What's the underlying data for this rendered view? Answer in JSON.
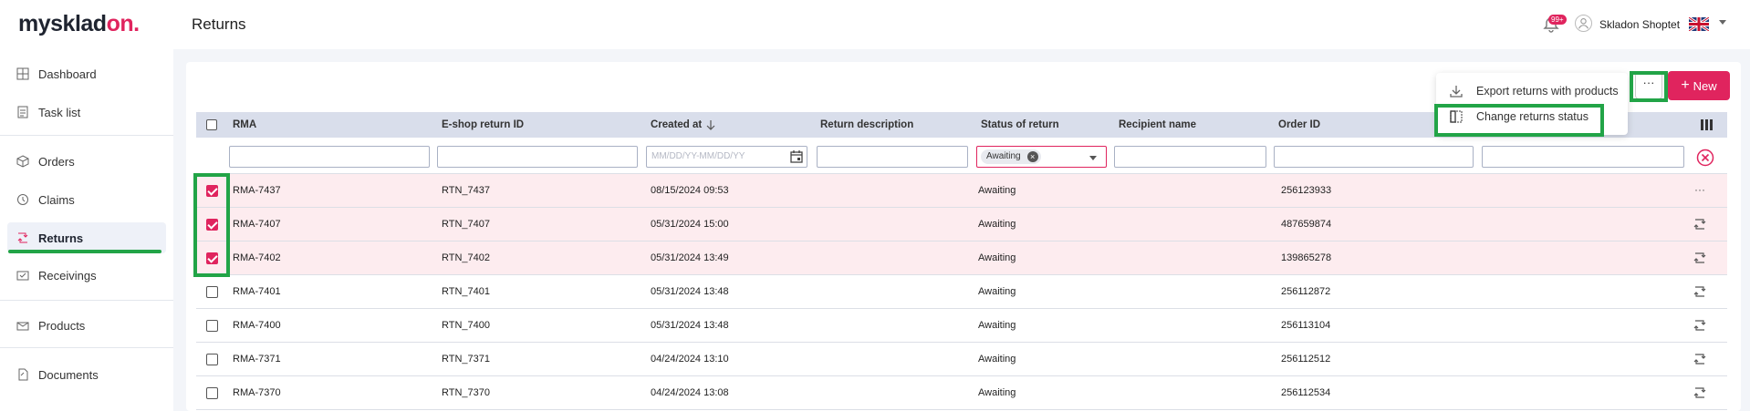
{
  "header": {
    "logo_main": "mysklad",
    "logo_accent": "on",
    "logo_dot": ".",
    "page_title": "Returns",
    "notification_badge": "99+",
    "user_name": "Skladon Shoptet"
  },
  "sidebar": {
    "items": [
      {
        "label": "Dashboard",
        "icon": "dashboard-icon"
      },
      {
        "label": "Task list",
        "icon": "task-list-icon"
      },
      {
        "label": "Orders",
        "icon": "box-icon"
      },
      {
        "label": "Claims",
        "icon": "claims-icon"
      },
      {
        "label": "Returns",
        "icon": "returns-icon",
        "active": true
      },
      {
        "label": "Receivings",
        "icon": "receivings-icon"
      },
      {
        "label": "Products",
        "icon": "products-icon"
      },
      {
        "label": "Documents",
        "icon": "documents-icon"
      }
    ]
  },
  "toolbar": {
    "new_label": "New",
    "more_label": "···"
  },
  "menu": {
    "export_label": "Export returns with products",
    "change_status_label": "Change returns status"
  },
  "table": {
    "columns": [
      "RMA",
      "E-shop return ID",
      "Created at",
      "Return description",
      "Status of return",
      "Recipient name",
      "Order ID"
    ],
    "date_placeholder": "MM/DD/YY-MM/DD/YY",
    "status_filter": "Awaiting",
    "rows": [
      {
        "rma": "RMA-7437",
        "eshop": "RTN_7437",
        "created": "08/15/2024 09:53",
        "status": "Awaiting",
        "order": "256123933",
        "checked": true
      },
      {
        "rma": "RMA-7407",
        "eshop": "RTN_7407",
        "created": "05/31/2024 15:00",
        "status": "Awaiting",
        "order": "487659874",
        "checked": true
      },
      {
        "rma": "RMA-7402",
        "eshop": "RTN_7402",
        "created": "05/31/2024 13:49",
        "status": "Awaiting",
        "order": "139865278",
        "checked": true
      },
      {
        "rma": "RMA-7401",
        "eshop": "RTN_7401",
        "created": "05/31/2024 13:48",
        "status": "Awaiting",
        "order": "256112872",
        "checked": false
      },
      {
        "rma": "RMA-7400",
        "eshop": "RTN_7400",
        "created": "05/31/2024 13:48",
        "status": "Awaiting",
        "order": "256113104",
        "checked": false
      },
      {
        "rma": "RMA-7371",
        "eshop": "RTN_7371",
        "created": "04/24/2024 13:10",
        "status": "Awaiting",
        "order": "256112512",
        "checked": false
      },
      {
        "rma": "RMA-7370",
        "eshop": "RTN_7370",
        "created": "04/24/2024 13:08",
        "status": "Awaiting",
        "order": "256112534",
        "checked": false
      }
    ]
  },
  "colors": {
    "accent": "#e0245e",
    "highlight": "#22a447",
    "header_row": "#d9deeb",
    "selected_row": "#fdecef"
  }
}
